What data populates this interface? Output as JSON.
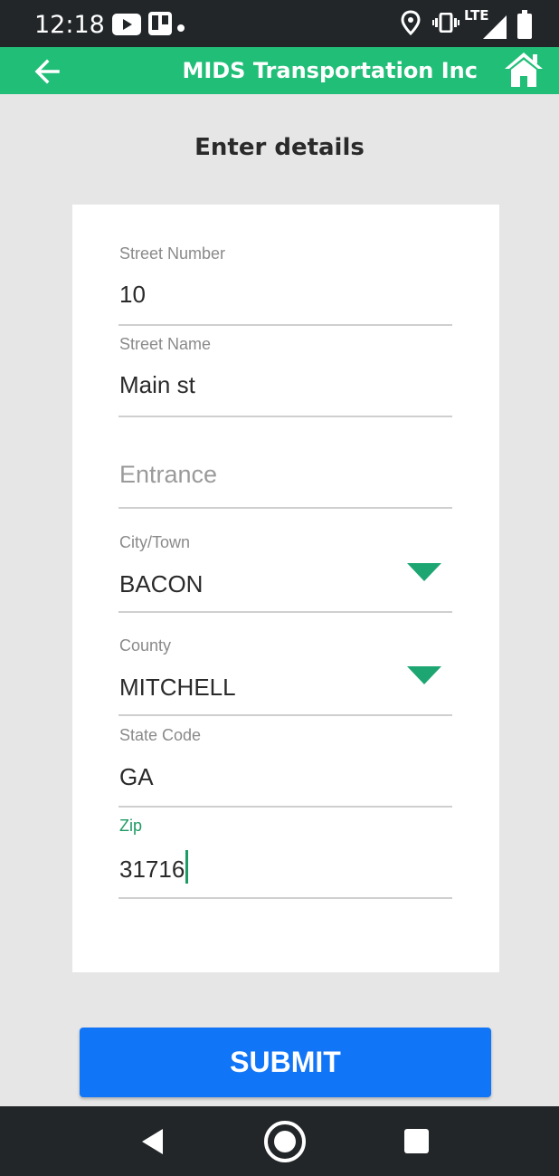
{
  "status_bar": {
    "time": "12:18",
    "network": "LTE"
  },
  "app_bar": {
    "title": "MIDS Transportation Inc"
  },
  "form": {
    "heading": "Enter details",
    "street_number": {
      "label": "Street Number",
      "value": "10"
    },
    "street_name": {
      "label": "Street Name",
      "value": "Main st"
    },
    "entrance": {
      "placeholder": "Entrance"
    },
    "city": {
      "label": "City/Town",
      "value": "BACON"
    },
    "county": {
      "label": "County",
      "value": "MITCHELL"
    },
    "state_code": {
      "label": "State Code",
      "value": "GA"
    },
    "zip": {
      "label": "Zip",
      "value": "31716"
    },
    "submit_label": "SUBMIT"
  },
  "colors": {
    "accent_green": "#21be78",
    "submit_blue": "#1175f7",
    "system_bar": "#222629"
  }
}
